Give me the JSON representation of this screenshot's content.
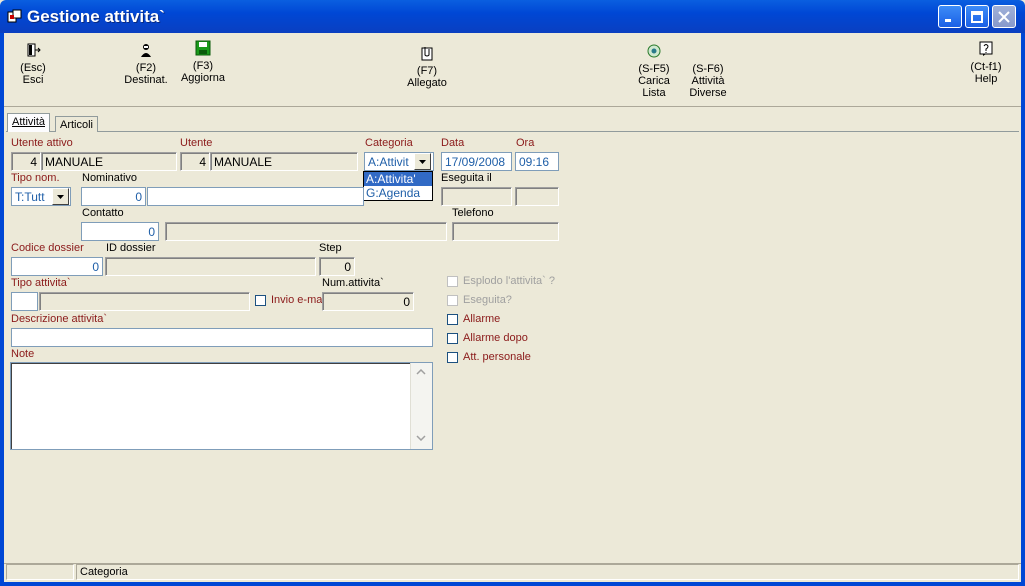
{
  "window": {
    "title": "Gestione attivita`"
  },
  "toolbar": {
    "esc": {
      "key": "(Esc)",
      "label": "Esci"
    },
    "f2": {
      "key": "(F2)",
      "label": "Destinat."
    },
    "f3": {
      "key": "(F3)",
      "label": "Aggiorna"
    },
    "f7": {
      "key": "(F7)",
      "label": "Allegato"
    },
    "sf5": {
      "key": "(S-F5)",
      "label": "Carica",
      "label2": "Lista"
    },
    "sf6": {
      "key": "(S-F6)",
      "label": "Attività",
      "label2": "Diverse"
    },
    "ctf1": {
      "key": "(Ct-f1)",
      "label": "Help"
    }
  },
  "tabs": [
    {
      "label": "Attività"
    },
    {
      "label": "Articoli"
    }
  ],
  "form": {
    "utente_attivo": {
      "label": "Utente attivo",
      "id": "4",
      "name": "MANUALE"
    },
    "utente": {
      "label": "Utente",
      "id": "4",
      "name": "MANUALE"
    },
    "categoria": {
      "label": "Categoria",
      "value": "A:Attivit",
      "options": [
        "A:Attivita'",
        "G:Agenda"
      ]
    },
    "data": {
      "label": "Data",
      "value": "17/09/2008"
    },
    "ora": {
      "label": "Ora",
      "value": "09:16"
    },
    "tipo_nom": {
      "label": "Tipo nom.",
      "value": "T:Tutt"
    },
    "nominativo": {
      "label": "Nominativo",
      "id": "0",
      "name": ""
    },
    "eseguita_il": {
      "label": "Eseguita il"
    },
    "contatto": {
      "label": "Contatto",
      "id": "0"
    },
    "telefono": {
      "label": "Telefono"
    },
    "codice_dossier": {
      "label": "Codice dossier",
      "value": "0"
    },
    "id_dossier": {
      "label": "ID dossier"
    },
    "step": {
      "label": "Step",
      "value": "0"
    },
    "tipo_attivita": {
      "label": "Tipo attivita`"
    },
    "invio_email": {
      "label": "Invio e-ma"
    },
    "num_attivita": {
      "label": "Num.attivita`",
      "value": "0"
    },
    "descrizione": {
      "label": "Descrizione attivita`"
    },
    "note": {
      "label": "Note"
    },
    "checkboxes": {
      "esplodo": "Esplodo l'attivita` ?",
      "eseguita": "Eseguita?",
      "allarme": "Allarme",
      "allarme_dopo": "Allarme dopo",
      "att_personale": "Att. personale"
    }
  },
  "status": {
    "cell1": "",
    "cell2": "Categoria"
  }
}
